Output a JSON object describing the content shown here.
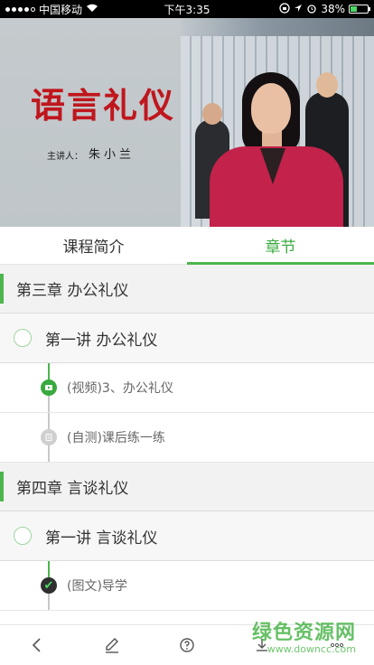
{
  "status_bar": {
    "carrier": "中国移动",
    "time": "下午3:35",
    "battery_percent": "38%",
    "battery_level": 0.38
  },
  "video": {
    "slide_title": "语言礼仪",
    "lecturer_label": "主讲人：",
    "lecturer_name": "朱小兰"
  },
  "tabs": [
    {
      "label": "课程简介",
      "active": false
    },
    {
      "label": "章节",
      "active": true
    }
  ],
  "chapters": [
    {
      "title": "第三章  办公礼仪",
      "lecture": "第一讲 办公礼仪",
      "items": [
        {
          "label": "(视频)3、办公礼仪",
          "icon": "video-play-icon"
        },
        {
          "label": "(自测)课后练一练",
          "icon": "quiz-icon"
        }
      ]
    },
    {
      "title": "第四章  言谈礼仪",
      "lecture": "第一讲 言谈礼仪",
      "items": [
        {
          "label": "(图文)导学",
          "icon": "check-icon"
        }
      ]
    }
  ],
  "toolbar": {
    "icons": [
      "back-icon",
      "edit-icon",
      "question-icon",
      "download-icon",
      "more-icon"
    ]
  },
  "watermark": {
    "main": "绿色资源网",
    "sub": "www.downcc.com"
  },
  "colors": {
    "accent": "#4cb64c",
    "status_bar_bg": "#000000"
  }
}
